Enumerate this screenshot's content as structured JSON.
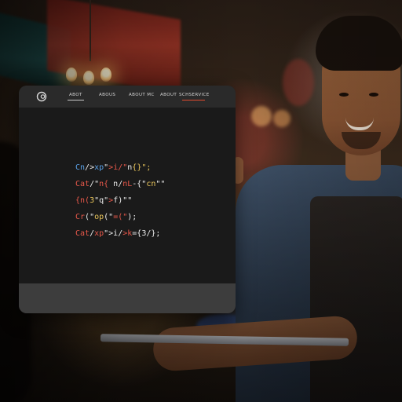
{
  "colors": {
    "window_nav_bg": "#2a2a2a",
    "window_content_bg": "#1a1a1a",
    "window_bottom_bg": "#3d3d3d",
    "accent_underline_active": "#c8c8c8",
    "accent_underline_highlight": "#e04a2e",
    "code_blue": "#5aa0e6",
    "code_red": "#e8584a",
    "code_white": "#ececec",
    "code_yellow": "#e8c45a",
    "code_green": "#8ed07a"
  },
  "nav": {
    "logo_icon": "circle-logo-icon",
    "items": [
      {
        "label": "ABOT",
        "active": true,
        "underline": "accent_underline_active"
      },
      {
        "label": "ABOUS",
        "active": false
      },
      {
        "label": "ABOUT  MC",
        "active": false
      },
      {
        "label": "ABOUT",
        "active": false
      },
      {
        "label": "SCHSERVICE",
        "active": false,
        "underline": "accent_underline_highlight"
      }
    ]
  },
  "code": {
    "lines": [
      {
        "tokens": [
          {
            "text": "Cn",
            "color": "code_blue"
          },
          {
            "text": "/>",
            "color": "code_white"
          },
          {
            "text": "xp",
            "color": "code_blue"
          },
          {
            "text": "\"",
            "color": "code_white"
          },
          {
            "text": ">i/\"",
            "color": "code_red"
          },
          {
            "text": "n",
            "color": "code_white"
          },
          {
            "text": "{}\";",
            "color": "code_yellow"
          }
        ]
      },
      {
        "tokens": [
          {
            "text": "Cat",
            "color": "code_red"
          },
          {
            "text": "/\"",
            "color": "code_white"
          },
          {
            "text": "n{",
            "color": "code_red"
          },
          {
            "text": " n/",
            "color": "code_white"
          },
          {
            "text": "nL",
            "color": "code_red"
          },
          {
            "text": "-{\"",
            "color": "code_white"
          },
          {
            "text": "cn",
            "color": "code_yellow"
          },
          {
            "text": "\"\"",
            "color": "code_white"
          }
        ]
      },
      {
        "tokens": [
          {
            "text": "{n(",
            "color": "code_red"
          },
          {
            "text": "3",
            "color": "code_yellow"
          },
          {
            "text": "\"q\"",
            "color": "code_white"
          },
          {
            "text": ">",
            "color": "code_red"
          },
          {
            "text": "f)\"\"",
            "color": "code_white"
          }
        ]
      },
      {
        "tokens": [
          {
            "text": "Cr",
            "color": "code_red"
          },
          {
            "text": "(\"",
            "color": "code_white"
          },
          {
            "text": "op",
            "color": "code_yellow"
          },
          {
            "text": "(\"",
            "color": "code_white"
          },
          {
            "text": "=(\"",
            "color": "code_red"
          },
          {
            "text": ");",
            "color": "code_white"
          }
        ]
      },
      {
        "tokens": [
          {
            "text": "Cat",
            "color": "code_red"
          },
          {
            "text": "/",
            "color": "code_white"
          },
          {
            "text": "xp",
            "color": "code_red"
          },
          {
            "text": "\">i/",
            "color": "code_white"
          },
          {
            "text": ">k",
            "color": "code_red"
          },
          {
            "text": "={3/};",
            "color": "code_white"
          }
        ]
      }
    ]
  }
}
